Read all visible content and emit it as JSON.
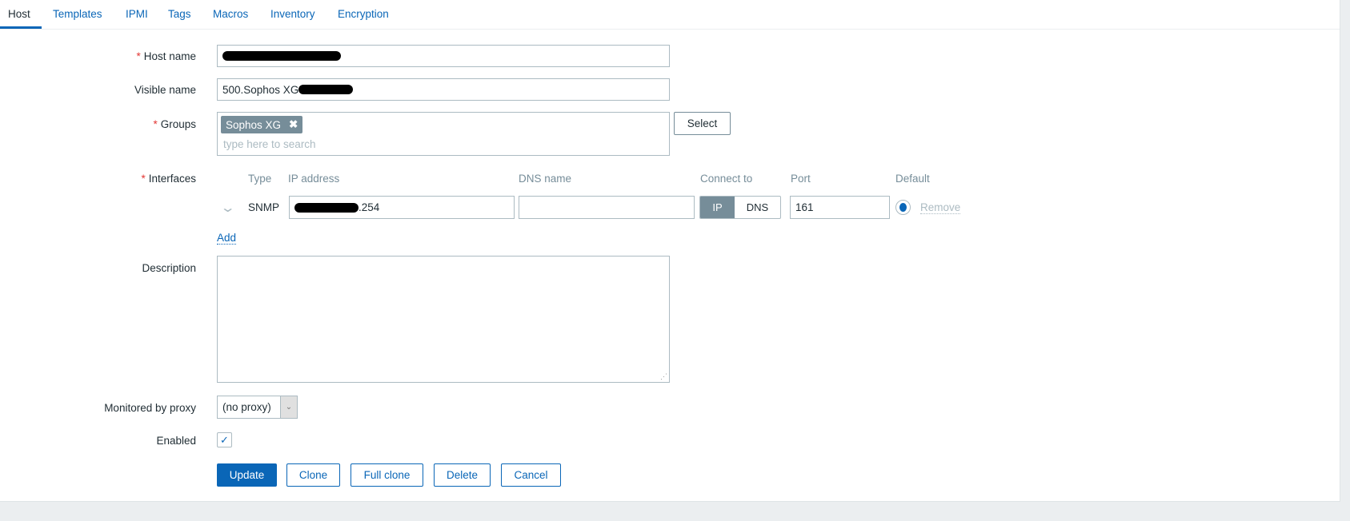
{
  "tabs": [
    "Host",
    "Templates",
    "IPMI",
    "Tags",
    "Macros",
    "Inventory",
    "Encryption"
  ],
  "form": {
    "host_name_label": "Host name",
    "visible_name_label": "Visible name",
    "visible_name_value": "500.Sophos XG",
    "groups_label": "Groups",
    "group_tag": "Sophos XG",
    "groups_placeholder": "type here to search",
    "select_label": "Select",
    "interfaces_label": "Interfaces",
    "iface_headers": {
      "type": "Type",
      "ip": "IP address",
      "dns": "DNS name",
      "connect": "Connect to",
      "port": "Port",
      "default": "Default"
    },
    "iface": {
      "type": "SNMP",
      "ip_suffix": ".254",
      "dns": "",
      "connect_ip": "IP",
      "connect_dns": "DNS",
      "port": "161",
      "remove": "Remove"
    },
    "add_label": "Add",
    "description_label": "Description",
    "proxy_label": "Monitored by proxy",
    "proxy_value": "(no proxy)",
    "enabled_label": "Enabled",
    "enabled": true
  },
  "buttons": {
    "update": "Update",
    "clone": "Clone",
    "full_clone": "Full clone",
    "delete": "Delete",
    "cancel": "Cancel"
  },
  "colors": {
    "accent": "#0a66b7",
    "tag": "#768d99"
  }
}
